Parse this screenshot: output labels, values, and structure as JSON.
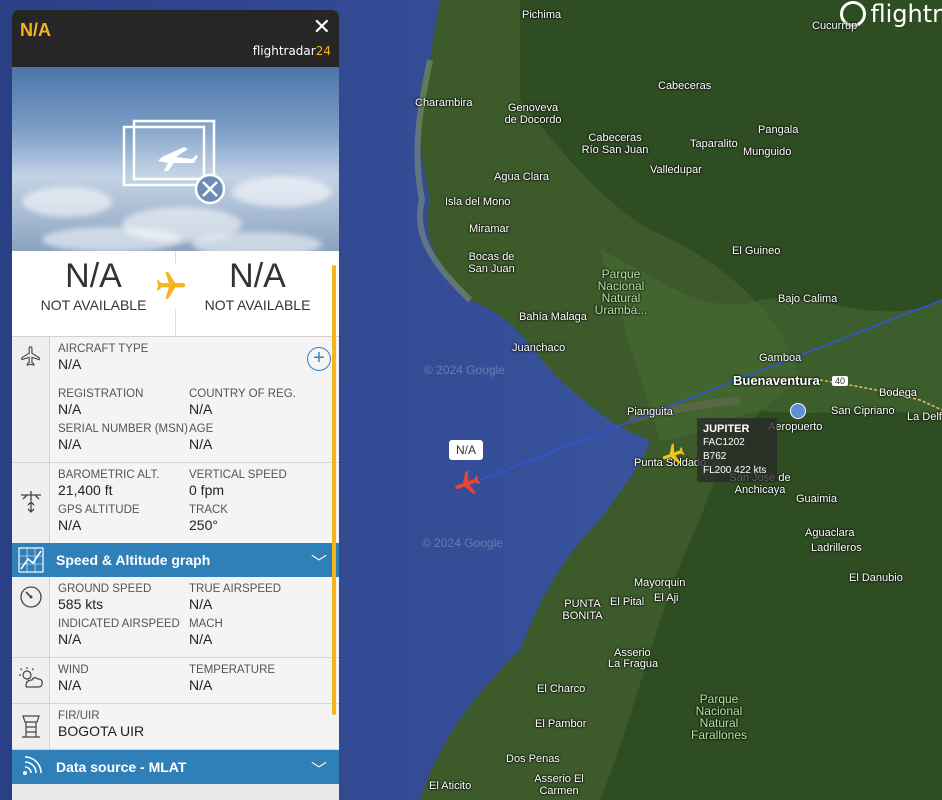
{
  "panel": {
    "title": "N/A",
    "brand_main": "flightradar",
    "brand_num": "24",
    "origin": {
      "code": "N/A",
      "name": "NOT AVAILABLE"
    },
    "destination": {
      "code": "N/A",
      "name": "NOT AVAILABLE"
    },
    "aircraft": {
      "type_label": "AIRCRAFT TYPE",
      "type_value": "N/A",
      "reg_label": "REGISTRATION",
      "reg_value": "N/A",
      "country_label": "COUNTRY OF REG.",
      "country_value": "N/A",
      "msn_label": "SERIAL NUMBER (MSN)",
      "msn_value": "N/A",
      "age_label": "AGE",
      "age_value": "N/A"
    },
    "altitude": {
      "baro_label": "BAROMETRIC ALT.",
      "baro_value": "21,400 ft",
      "vs_label": "VERTICAL SPEED",
      "vs_value": "0 fpm",
      "gps_label": "GPS ALTITUDE",
      "gps_value": "N/A",
      "track_label": "TRACK",
      "track_value": "250°"
    },
    "graph_bar": "Speed & Altitude graph",
    "speed": {
      "gs_label": "GROUND SPEED",
      "gs_value": "585 kts",
      "tas_label": "TRUE AIRSPEED",
      "tas_value": "N/A",
      "ias_label": "INDICATED AIRSPEED",
      "ias_value": "N/A",
      "mach_label": "MACH",
      "mach_value": "N/A"
    },
    "weather": {
      "wind_label": "WIND",
      "wind_value": "N/A",
      "temp_label": "TEMPERATURE",
      "temp_value": "N/A"
    },
    "fir": {
      "label": "FIR/UIR",
      "value": "BOGOTA UIR"
    },
    "source_bar": "Data source - MLAT"
  },
  "map": {
    "logo": "flightr",
    "selected_tag": "N/A",
    "other_flight": {
      "callsign": "JUPITER",
      "reg": "FAC1202",
      "type": "B762",
      "alt_speed": "FL200 422 kts"
    },
    "road_badge": "40",
    "watermark": "© 2024 Google",
    "places": [
      "Pichima",
      "Cucurrup",
      "Cabeceras",
      "Charambira",
      "Genoveva de Docordo",
      "Cabeceras Río San Juan",
      "Taparalito",
      "Pangala",
      "Munguido",
      "Valledupar",
      "Agua Clara",
      "Isla del Mono",
      "Miramar",
      "Bocas de San Juan",
      "El Guineo",
      "Parque Nacional Natural Urambá...",
      "Bajo Calima",
      "Bahía Malaga",
      "Juanchaco",
      "Gamboa",
      "Buenaventura",
      "Bodega",
      "San Cipriano",
      "La Delf",
      "Aeropuerto",
      "Pianguita",
      "Punta Soldado",
      "San José de Anchicaya",
      "Guaimia",
      "Aguaclara",
      "Ladrilleros",
      "El Danubio",
      "Mayorquin",
      "El Aji",
      "El Pital",
      "PUNTA BONITA",
      "Asserio",
      "La Fragua",
      "El Charco",
      "Parque Nacional Natural Farallones",
      "El Pambor",
      "Dos Penas",
      "El Aticito",
      "Asserio El Carmen"
    ]
  }
}
